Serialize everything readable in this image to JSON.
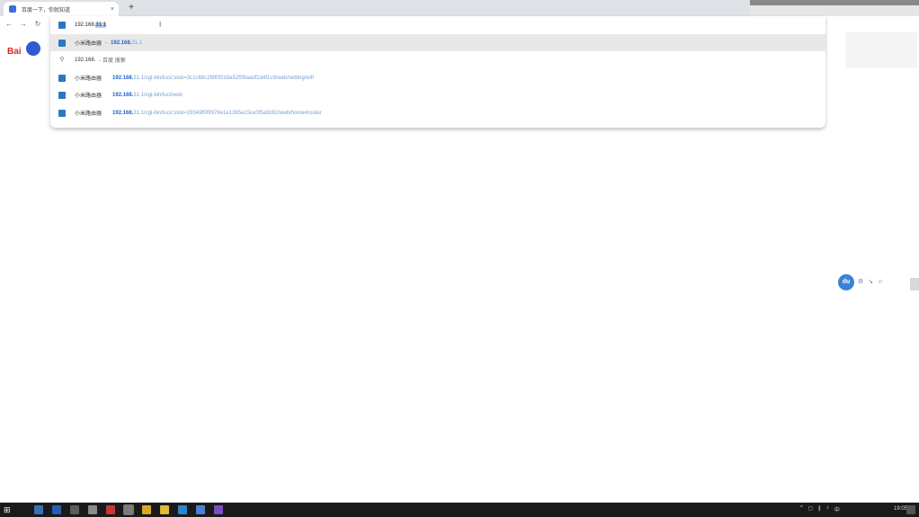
{
  "browser": {
    "tab": {
      "title": "百度一下，你就知道",
      "close": "×"
    },
    "new_tab": "+",
    "nav": {
      "back": "←",
      "forward": "→",
      "reload": "↻"
    }
  },
  "omnibox": {
    "typed": "192.168.",
    "selected_completion": "31.1",
    "suggestions": [
      {
        "type": "history",
        "title": "小米路由器",
        "url": "192.168.",
        "rest": "31.1",
        "selected": true
      },
      {
        "type": "search",
        "title": "192.168.",
        "url": "",
        "rest": "- 百度 搜索",
        "selected": false
      },
      {
        "type": "history",
        "title": "小米路由器",
        "url": "192.168.",
        "rest": "31.1/cgi-bin/luci/;stok=3c1c68c2f8f0f2d3a52f09aadf1d4f1c9/web/setting/wifi",
        "selected": false
      },
      {
        "type": "history",
        "title": "小米路由器",
        "url": "192.168.",
        "rest": "31.1/cgi-bin/luci/web",
        "selected": false
      },
      {
        "type": "history",
        "title": "小米路由器",
        "url": "192.168.",
        "rest": "31.1/cgi-bin/luci/;stok=29349f0f9976e1e1285e15ce0f5a5b92/web/home#router",
        "selected": false
      }
    ]
  },
  "page": {
    "logo_text": "Bai",
    "side_badge": "du"
  },
  "taskbar": {
    "start": "⊞",
    "apps": [
      {
        "color": "#3d6fb5"
      },
      {
        "color": "#2a5db0"
      },
      {
        "color": "#5c5c5c"
      },
      {
        "color": "#8b8b8b"
      },
      {
        "color": "#c8343a"
      },
      {
        "color": "#7b7b7b"
      },
      {
        "color": "#d9a62a"
      },
      {
        "color": "#e0b83a"
      },
      {
        "color": "#2c83cf"
      },
      {
        "color": "#4f7fcf"
      },
      {
        "color": "#7b4fc4"
      }
    ],
    "tray": [
      "^",
      "◻",
      "∥",
      "♪",
      "中"
    ],
    "clock": "19:05"
  }
}
